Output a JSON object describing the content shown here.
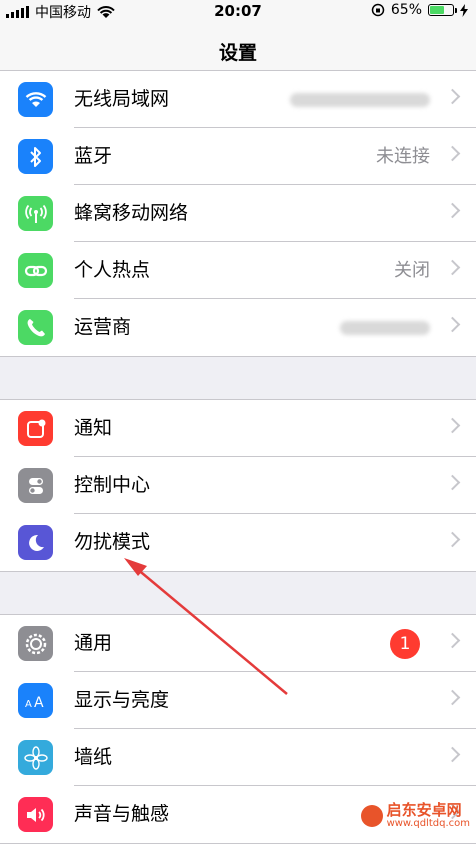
{
  "status_bar": {
    "carrier": "中国移动",
    "time": "20:07",
    "battery_percent": "65%",
    "battery_level": 0.65
  },
  "nav": {
    "title": "设置"
  },
  "group1": [
    {
      "label": "无线局域网",
      "value": "",
      "icon": "wifi-icon",
      "color": "#1a82fb"
    },
    {
      "label": "蓝牙",
      "value": "未连接",
      "icon": "bluetooth-icon",
      "color": "#1a82fb"
    },
    {
      "label": "蜂窝移动网络",
      "value": "",
      "icon": "antenna-icon",
      "color": "#4cd964"
    },
    {
      "label": "个人热点",
      "value": "关闭",
      "icon": "hotspot-icon",
      "color": "#4cd964"
    },
    {
      "label": "运营商",
      "value": "",
      "icon": "phone-icon",
      "color": "#4cd964"
    }
  ],
  "group2": [
    {
      "label": "通知",
      "icon": "notification-icon",
      "color": "#ff3b30"
    },
    {
      "label": "控制中心",
      "icon": "control-center-icon",
      "color": "#8e8e93"
    },
    {
      "label": "勿扰模式",
      "icon": "moon-icon",
      "color": "#5856d6"
    }
  ],
  "group3": [
    {
      "label": "通用",
      "badge": "1",
      "icon": "gear-icon",
      "color": "#8e8e93"
    },
    {
      "label": "显示与亮度",
      "icon": "text-size-icon",
      "color": "#1a82fb"
    },
    {
      "label": "墙纸",
      "icon": "flower-icon",
      "color": "#34aadc"
    },
    {
      "label": "声音与触感",
      "icon": "speaker-icon",
      "color": "#ff2d55"
    }
  ],
  "watermark": {
    "title": "启东安卓网",
    "url": "www.qdltdq.com"
  }
}
